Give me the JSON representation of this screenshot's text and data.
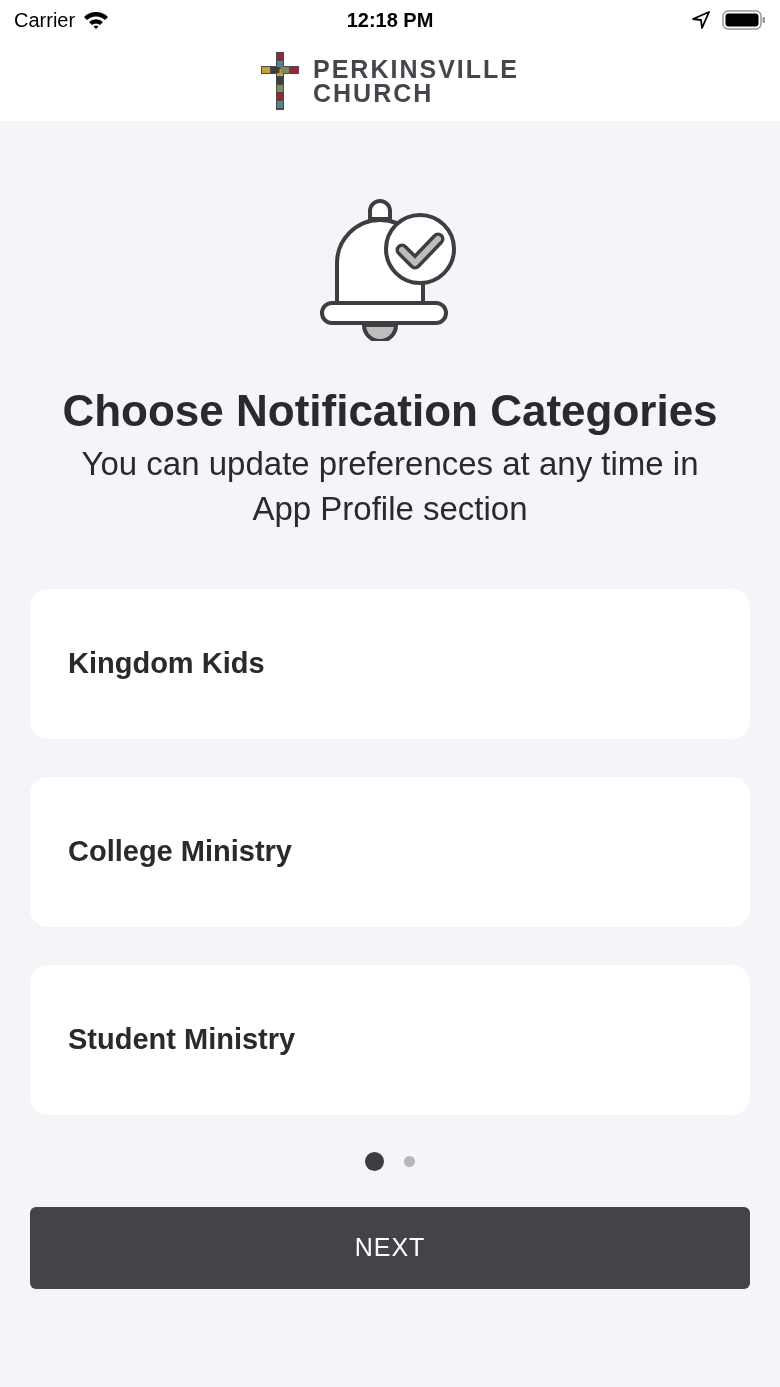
{
  "status_bar": {
    "carrier": "Carrier",
    "time": "12:18 PM"
  },
  "logo": {
    "lines": [
      "PERKINSVILLE",
      "CHURCH"
    ]
  },
  "title": "Choose Notification Categories",
  "subtitle": "You can update preferences at any time in App Profile section",
  "categories": [
    {
      "label": "Kingdom Kids"
    },
    {
      "label": "College Ministry"
    },
    {
      "label": "Student Ministry"
    }
  ],
  "pages": [
    {
      "selected": true
    },
    {
      "selected": false
    }
  ],
  "next_button": "NEXT"
}
